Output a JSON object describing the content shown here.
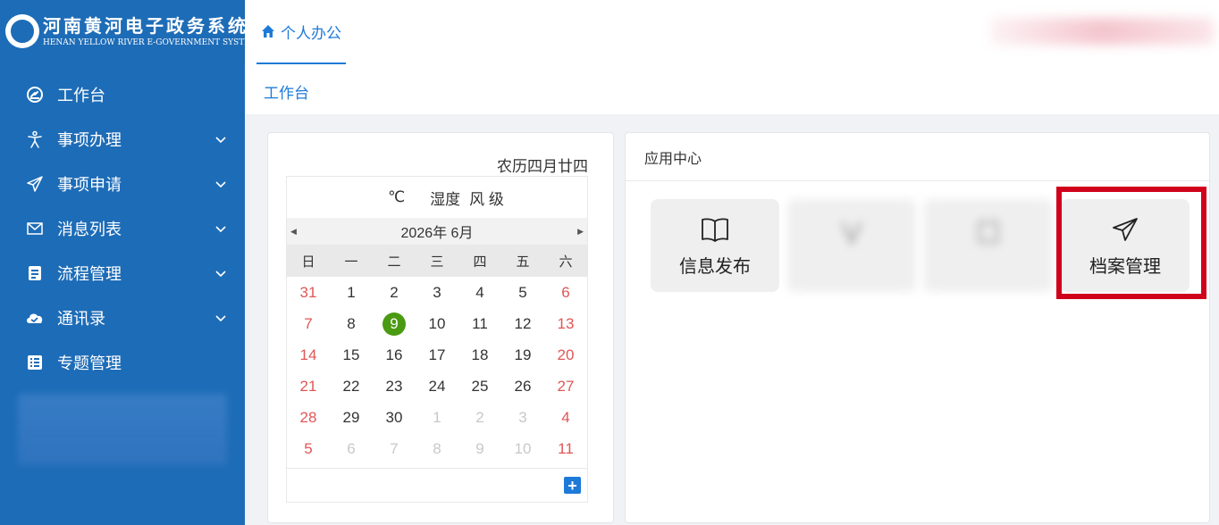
{
  "brand": {
    "title_cn": "河南黄河电子政务系统",
    "title_en": "HENAN YELLOW RIVER E-GOVERNMENT SYSTEM"
  },
  "sidebar": {
    "items": [
      {
        "label": "工作台",
        "icon": "dashboard-icon",
        "has_arrow": false
      },
      {
        "label": "事项办理",
        "icon": "person-icon",
        "has_arrow": true
      },
      {
        "label": "事项申请",
        "icon": "paper-plane-icon",
        "has_arrow": true
      },
      {
        "label": "消息列表",
        "icon": "envelope-icon",
        "has_arrow": true
      },
      {
        "label": "流程管理",
        "icon": "document-icon",
        "has_arrow": true
      },
      {
        "label": "通讯录",
        "icon": "cloud-check-icon",
        "has_arrow": true
      },
      {
        "label": "专题管理",
        "icon": "list-icon",
        "has_arrow": false
      }
    ]
  },
  "topbar": {
    "tab_label": "个人办公"
  },
  "breadcrumb": "工作台",
  "calendar": {
    "lunar": "农历四月廿四",
    "weather": {
      "temp_unit": "℃",
      "humidity": "湿度",
      "wind": "风 级"
    },
    "month_label": "2026年 6月",
    "weekdays": [
      "日",
      "一",
      "二",
      "三",
      "四",
      "五",
      "六"
    ],
    "today": 9,
    "weeks": [
      [
        31,
        1,
        2,
        3,
        4,
        5,
        6
      ],
      [
        7,
        8,
        9,
        10,
        11,
        12,
        13
      ],
      [
        14,
        15,
        16,
        17,
        18,
        19,
        20
      ],
      [
        21,
        22,
        23,
        24,
        25,
        26,
        27
      ],
      [
        28,
        29,
        30,
        1,
        2,
        3,
        4
      ],
      [
        5,
        6,
        7,
        8,
        9,
        10,
        11
      ]
    ],
    "add_symbol": "+"
  },
  "app_center": {
    "title": "应用中心",
    "tiles": [
      {
        "label": "信息发布",
        "icon": "book-icon",
        "blurred": false,
        "highlighted": false
      },
      {
        "label": "",
        "icon": "blurred-icon",
        "blurred": true,
        "highlighted": false
      },
      {
        "label": "",
        "icon": "blurred-icon",
        "blurred": true,
        "highlighted": false
      },
      {
        "label": "档案管理",
        "icon": "paper-plane-icon",
        "blurred": false,
        "highlighted": true
      }
    ]
  },
  "colors": {
    "sidebar_bg": "#1d6cb7",
    "accent": "#1d7ad8",
    "weekend": "#e05656",
    "today": "#4a9a12",
    "highlight": "#d0021b"
  }
}
